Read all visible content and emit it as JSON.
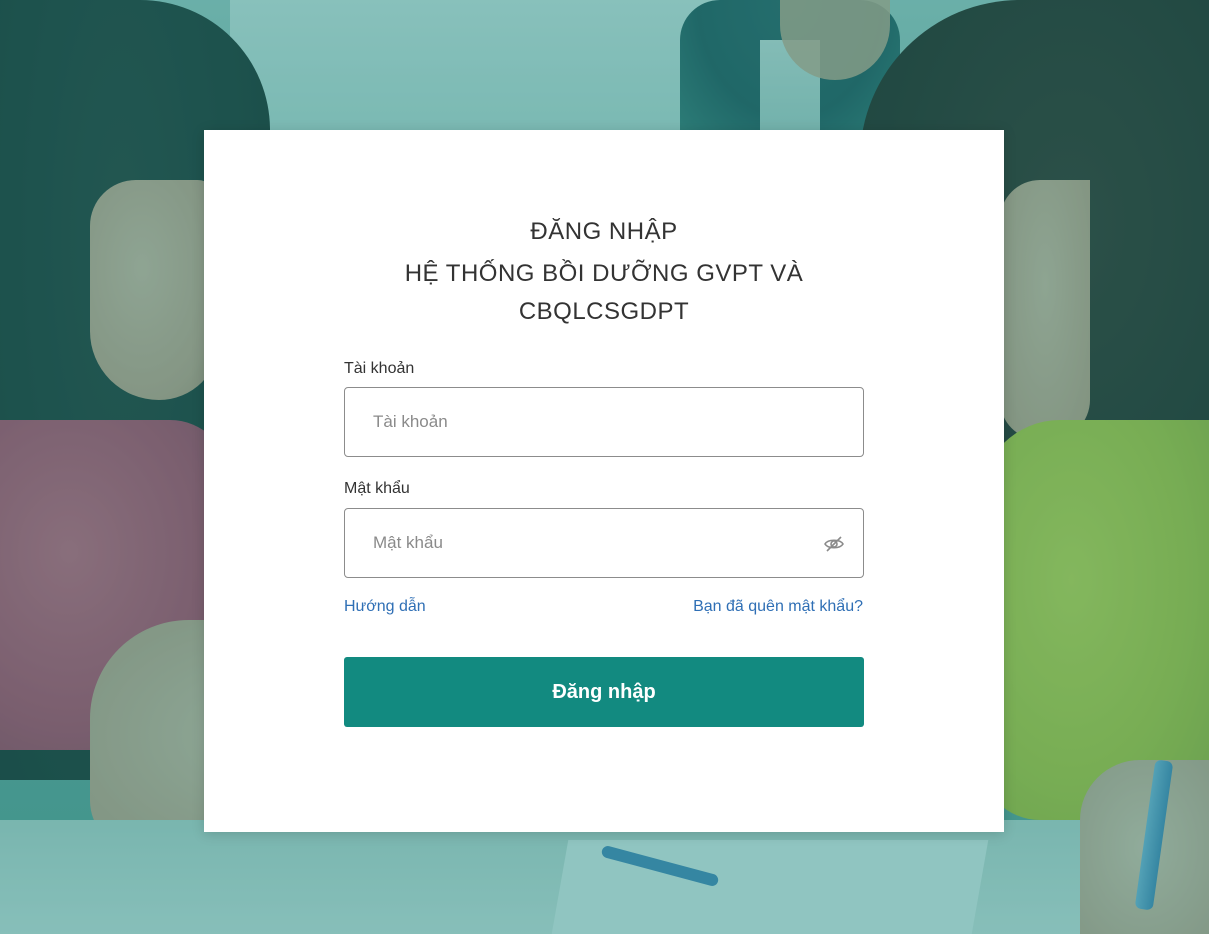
{
  "login": {
    "title_line1": "ĐĂNG NHẬP",
    "title_line2": "HỆ THỐNG BỒI DƯỠNG GVPT VÀ",
    "title_line3": "CBQLCSGDPT",
    "username_label": "Tài khoản",
    "username_placeholder": "Tài khoản",
    "username_value": "",
    "password_label": "Mật khẩu",
    "password_placeholder": "Mật khẩu",
    "password_value": "",
    "password_toggle_icon": "eye-slash-icon",
    "guide_link": "Hướng dẫn",
    "forgot_link": "Bạn đã quên mật khẩu?",
    "submit_label": "Đăng nhập"
  },
  "colors": {
    "primary": "#128a80",
    "link": "#2f6fb5",
    "overlay": "#16877d"
  }
}
